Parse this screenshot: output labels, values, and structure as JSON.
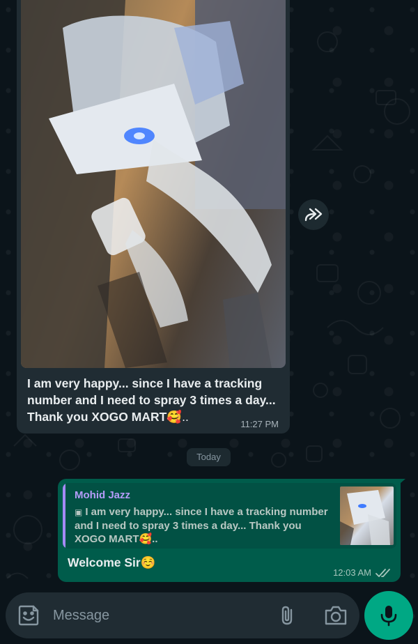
{
  "conversation": {
    "incoming": {
      "caption_line1": "I am very happy... since I have a tracking",
      "caption_line2": "number and I need to spray 3 times a day...",
      "caption_line3": "Thank you XOGO MART",
      "caption_emoji": "🥰..",
      "time": "11:27 PM"
    },
    "day_separator": "Today",
    "outgoing": {
      "quoted_author": "Mohid Jazz",
      "quoted_line1": "I am very happy... since I have a tracking number",
      "quoted_line2": "and I need to spray 3 times a day... Thank you",
      "quoted_line3": "XOGO MART",
      "quoted_emoji": "🥰..",
      "text": "Welcome Sir",
      "text_emoji": "☺️",
      "time": "12:03 AM"
    }
  },
  "composer": {
    "placeholder": "Message"
  },
  "colors": {
    "background": "#0b141a",
    "incoming_bubble": "#202c33",
    "outgoing_bubble": "#005c4b",
    "accent": "#00a884",
    "quote_author": "#b59cf9"
  },
  "icons": {
    "forward": "forward-icon",
    "emoji": "emoji-icon",
    "attach": "paperclip-icon",
    "camera": "camera-icon",
    "mic": "mic-icon",
    "read_receipt": "double-check-icon",
    "quoted_image": "image-icon"
  }
}
